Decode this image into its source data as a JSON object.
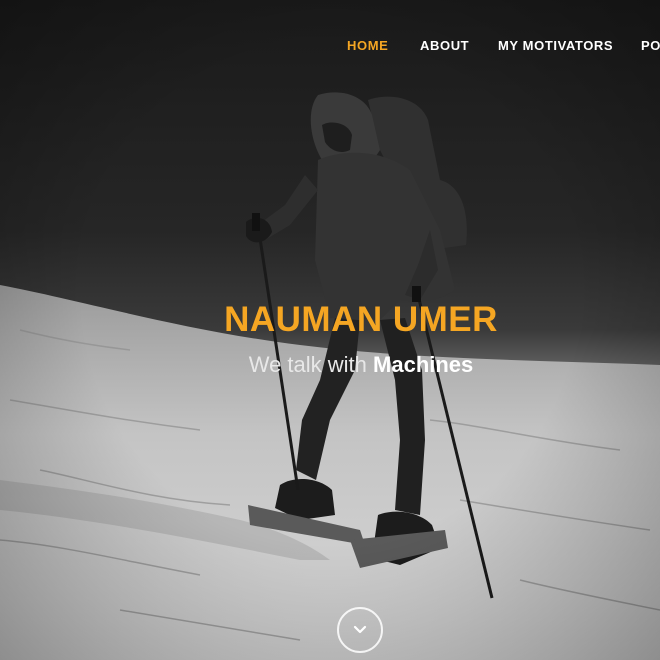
{
  "nav": {
    "items": [
      {
        "label": "HOME",
        "active": true
      },
      {
        "label": "ABOUT",
        "active": false
      },
      {
        "label": "MY MOTIVATORS",
        "active": false
      },
      {
        "label": "PO",
        "active": false
      }
    ]
  },
  "hero": {
    "title": "NAUMAN UMER",
    "tagline_prefix": "We talk with",
    "tagline_emphasis": "Machines",
    "scroll_icon": "chevron-down-icon",
    "image": "hiker-with-trekking-poles-on-snowy-slope"
  },
  "colors": {
    "accent": "#f5a623",
    "nav_text": "#ffffff",
    "tagline_text": "#e8e8e8"
  }
}
